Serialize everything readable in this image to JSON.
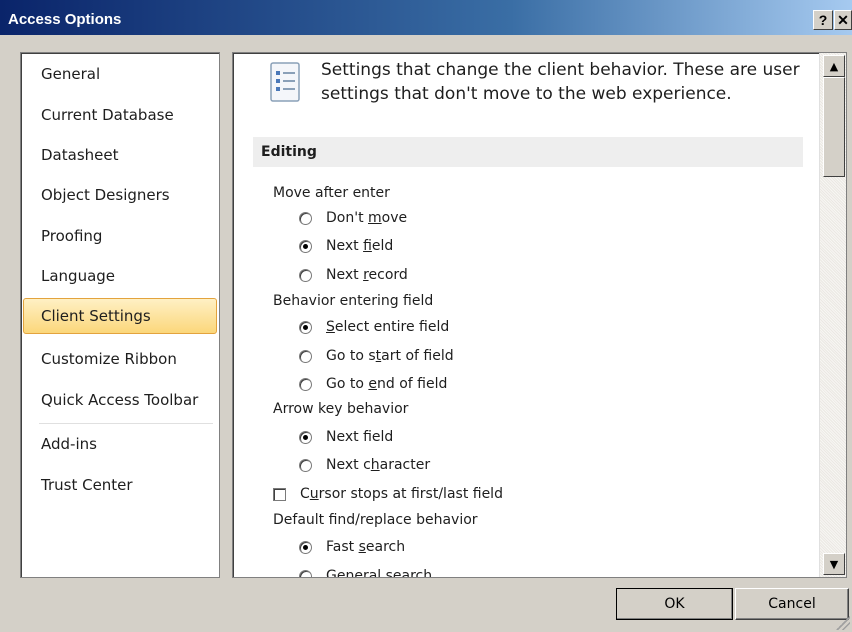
{
  "window": {
    "title": "Access Options",
    "help_label": "?",
    "close_label": "✕"
  },
  "nav": {
    "items": [
      {
        "label": "General"
      },
      {
        "label": "Current Database"
      },
      {
        "label": "Datasheet"
      },
      {
        "label": "Object Designers"
      },
      {
        "label": "Proofing"
      },
      {
        "label": "Language"
      },
      {
        "label": "Client Settings",
        "selected": true
      },
      {
        "label": "Customize Ribbon"
      },
      {
        "label": "Quick Access Toolbar"
      },
      {
        "label": "Add-ins"
      },
      {
        "label": "Trust Center"
      }
    ]
  },
  "content": {
    "intro": "Settings that change the client behavior. These are user settings that don't move to the web experience.",
    "section": "Editing",
    "move_after_enter": {
      "label": "Move after enter",
      "options": [
        {
          "pre": "Don't ",
          "u": "m",
          "post": "ove",
          "checked": false
        },
        {
          "pre": "Next ",
          "u": "f",
          "post": "ield",
          "checked": true
        },
        {
          "pre": "Next ",
          "u": "r",
          "post": "ecord",
          "checked": false
        }
      ]
    },
    "behavior_entering": {
      "label": "Behavior entering field",
      "options": [
        {
          "pre": "",
          "u": "S",
          "post": "elect entire field",
          "checked": true
        },
        {
          "pre": "Go to s",
          "u": "t",
          "post": "art of field",
          "checked": false
        },
        {
          "pre": "Go to ",
          "u": "e",
          "post": "nd of field",
          "checked": false
        }
      ]
    },
    "arrow_key": {
      "label": "Arrow key behavior",
      "options": [
        {
          "pre": "Next f",
          "u": "i",
          "post": "eld",
          "checked": true
        },
        {
          "pre": "Next c",
          "u": "h",
          "post": "aracter",
          "checked": false
        }
      ]
    },
    "cursor_stops": {
      "pre": "C",
      "u": "u",
      "post": "rsor stops at first/last field",
      "checked": false
    },
    "find_replace": {
      "label": "Default find/replace behavior",
      "options": [
        {
          "pre": "Fast ",
          "u": "s",
          "post": "earch",
          "checked": true
        },
        {
          "pre": "General search",
          "u": "",
          "post": "",
          "checked": false
        }
      ]
    }
  },
  "buttons": {
    "ok": "OK",
    "cancel": "Cancel"
  },
  "colors": {
    "selected_bg": "#fbd77b",
    "selected_border": "#e3a33d",
    "titlebar": "#0a246a"
  }
}
